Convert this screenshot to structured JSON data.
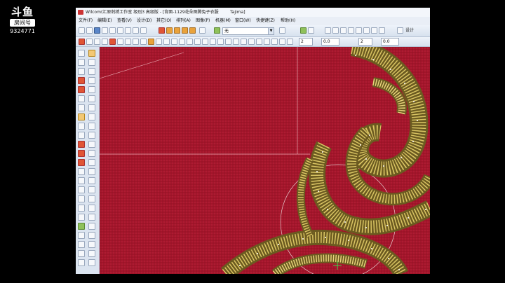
{
  "overlay": {
    "logo_text": "斗鱼",
    "room_label": "房间号",
    "room_number": "9324771"
  },
  "window": {
    "title": "Wilcom(汇原刺绣工作室  级别3 高级版 - [背面-1129花朵图腾兔子衣服",
    "machine": "Tajima]"
  },
  "menu": [
    "文件(F)",
    "编辑(E)",
    "查看(V)",
    "设计(D)",
    "其它(O)",
    "排列(A)",
    "图像(P)",
    "机器(M)",
    "窗口(W)",
    "快捷键(Z)",
    "帮助(H)"
  ],
  "toolbar": {
    "fabric_combo": "无",
    "design_info_label": "设计",
    "field_values": [
      "2",
      "0.0",
      "2",
      "0.0"
    ]
  },
  "colors": {
    "fabric": "#a3152a",
    "thread_gold": "#d9c463",
    "stitch_point": "#ffffff",
    "cursor": "#3cd94c"
  },
  "icons": [
    "arrow-select-icon",
    "reshape-icon",
    "zoom-icon",
    "pen-icon",
    "satin-icon",
    "fill-icon",
    "circle-icon",
    "text-icon",
    "run-icon",
    "star-icon",
    "cross-icon"
  ]
}
